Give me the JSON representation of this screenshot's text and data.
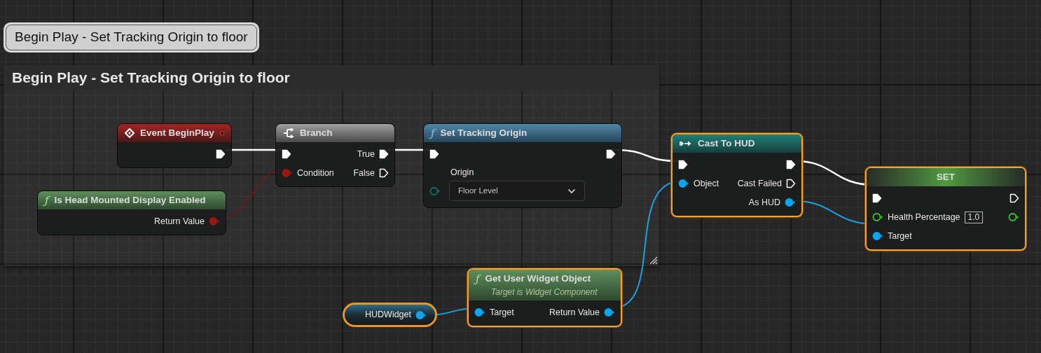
{
  "comment_bubble": {
    "text": "Begin Play - Set Tracking Origin to floor"
  },
  "comment_box": {
    "title": "Begin Play - Set Tracking Origin to floor"
  },
  "nodes": [
    {
      "kind": "event",
      "title": "Event BeginPlay",
      "selected": false,
      "outputs": [
        {
          "kind": "exec",
          "connected": true
        }
      ]
    },
    {
      "kind": "pure_function",
      "icon": "ƒ",
      "title": "Is Head Mounted Display Enabled",
      "selected": false,
      "outputs": [
        {
          "kind": "bool",
          "label": "Return Value",
          "connected": true
        }
      ]
    },
    {
      "kind": "branch",
      "title": "Branch",
      "selected": false,
      "inputs": [
        {
          "kind": "exec",
          "connected": true
        },
        {
          "kind": "bool",
          "label": "Condition",
          "connected": true
        }
      ],
      "outputs": [
        {
          "kind": "exec",
          "label": "True",
          "connected": true
        },
        {
          "kind": "exec",
          "label": "False",
          "connected": false
        }
      ]
    },
    {
      "kind": "function",
      "icon": "ƒ",
      "title": "Set Tracking Origin",
      "selected": false,
      "inputs": [
        {
          "kind": "exec",
          "connected": true
        },
        {
          "kind": "enum",
          "label": "Origin",
          "value": "Floor Level",
          "connected": false
        }
      ],
      "outputs": [
        {
          "kind": "exec",
          "connected": true
        }
      ]
    },
    {
      "kind": "cast",
      "title": "Cast To HUD",
      "selected": true,
      "inputs": [
        {
          "kind": "exec",
          "connected": true
        },
        {
          "kind": "object",
          "label": "Object",
          "connected": true
        }
      ],
      "outputs": [
        {
          "kind": "exec",
          "connected": true
        },
        {
          "kind": "exec",
          "label": "Cast Failed",
          "connected": false
        },
        {
          "kind": "object",
          "label": "As HUD",
          "connected": true
        }
      ]
    },
    {
      "kind": "set",
      "title": "SET",
      "selected": true,
      "inputs": [
        {
          "kind": "exec",
          "connected": true
        },
        {
          "kind": "float",
          "label": "Health Percentage",
          "value": "1.0",
          "connected": false
        },
        {
          "kind": "object",
          "label": "Target",
          "connected": true
        }
      ],
      "outputs": [
        {
          "kind": "exec",
          "connected": false
        },
        {
          "kind": "float",
          "connected": false
        }
      ]
    },
    {
      "kind": "variable",
      "title": "HUDWidget",
      "selected": true,
      "outputs": [
        {
          "kind": "object",
          "connected": true
        }
      ]
    },
    {
      "kind": "pure_function",
      "icon": "ƒ",
      "title": "Get User Widget Object",
      "subtitle": "Target is Widget Component",
      "selected": true,
      "inputs": [
        {
          "kind": "object",
          "label": "Target",
          "connected": true
        }
      ],
      "outputs": [
        {
          "kind": "object",
          "label": "Return Value",
          "connected": true
        }
      ]
    }
  ]
}
